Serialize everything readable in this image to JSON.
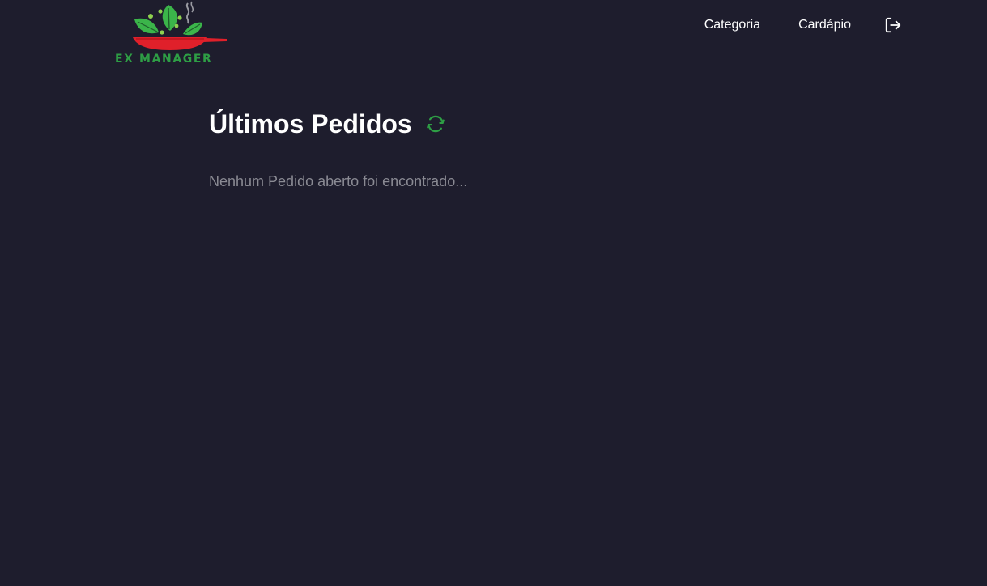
{
  "header": {
    "logo_text": "EX MANAGER",
    "logo_icon": "wok-pan-leaves-logo",
    "nav": {
      "category_label": "Categoria",
      "menu_label": "Cardápio"
    },
    "logout_icon": "logout-icon"
  },
  "main": {
    "title": "Últimos Pedidos",
    "refresh_icon": "refresh-icon",
    "empty_message": "Nenhum Pedido aberto foi encontrado..."
  },
  "colors": {
    "background": "#1e1d2d",
    "accent": "#2e9e45",
    "text": "#ffffff",
    "muted_text": "#8a8a93",
    "logo_pan": "#e0202a"
  }
}
